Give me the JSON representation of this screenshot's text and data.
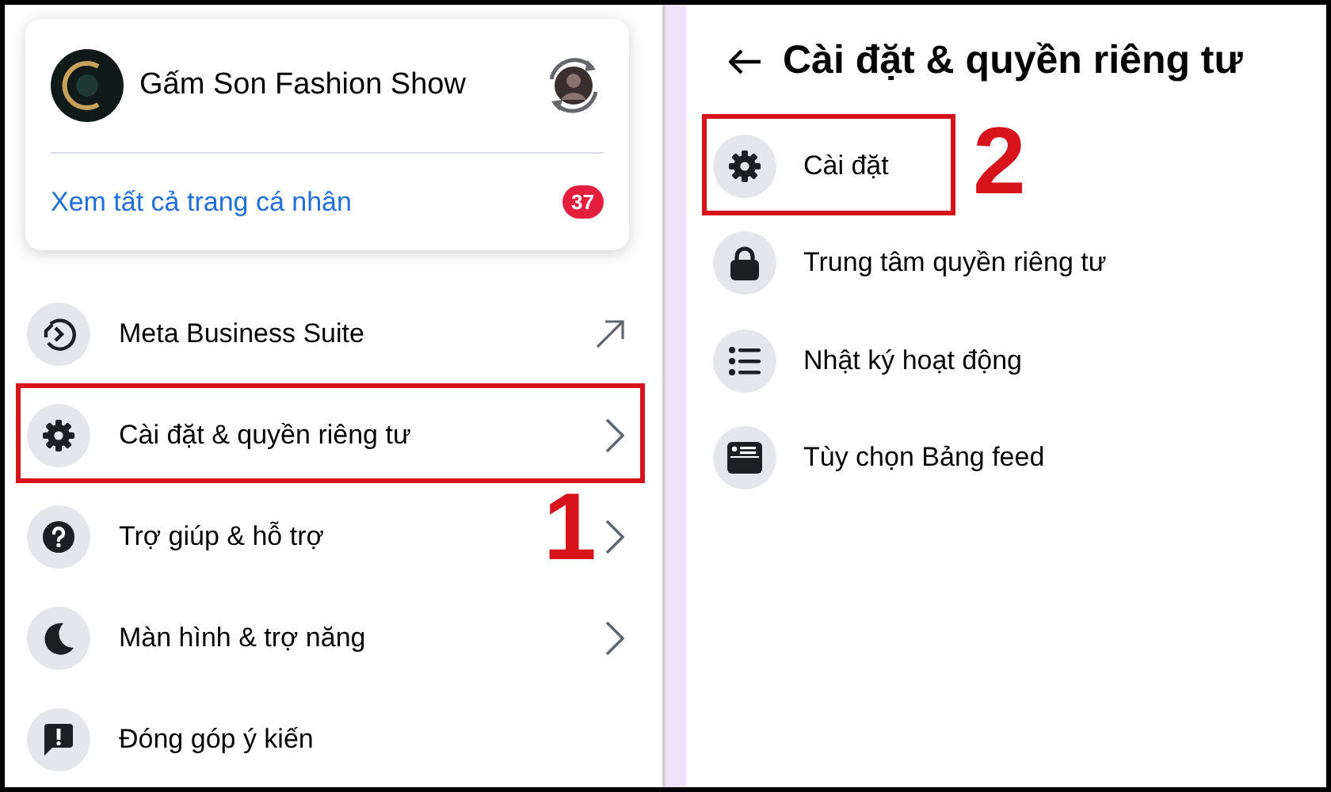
{
  "left_panel": {
    "profile_card": {
      "page_name": "Gấm Son Fashion Show",
      "see_all_link": "Xem tất cả trang cá nhân",
      "badge": "37"
    },
    "menu": [
      {
        "label": "Meta Business Suite",
        "kind": "external"
      },
      {
        "label": "Cài đặt & quyền riêng tư",
        "kind": "submenu",
        "callout": "1"
      },
      {
        "label": "Trợ giúp & hỗ trợ",
        "kind": "submenu"
      },
      {
        "label": "Màn hình & trợ năng",
        "kind": "submenu"
      },
      {
        "label": "Đóng góp ý kiến",
        "kind": "plain"
      }
    ]
  },
  "right_panel": {
    "title": "Cài đặt & quyền riêng tư",
    "items": [
      {
        "label": "Cài đặt",
        "callout": "2"
      },
      {
        "label": "Trung tâm quyền riêng tư"
      },
      {
        "label": "Nhật ký hoạt động"
      },
      {
        "label": "Tùy chọn Bảng feed"
      }
    ]
  }
}
